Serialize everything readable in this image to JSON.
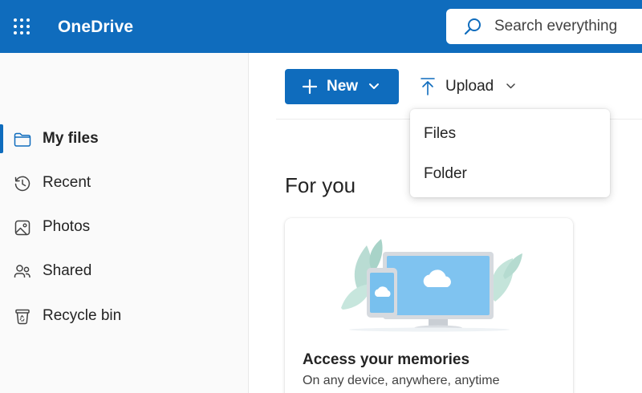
{
  "header": {
    "app_title": "OneDrive",
    "brand_color": "#0f6cbd",
    "search_placeholder": "Search everything"
  },
  "sidebar": {
    "items": [
      {
        "label": "My files",
        "icon": "folder-icon",
        "selected": true
      },
      {
        "label": "Recent",
        "icon": "history-icon",
        "selected": false
      },
      {
        "label": "Photos",
        "icon": "photo-icon",
        "selected": false
      },
      {
        "label": "Shared",
        "icon": "people-icon",
        "selected": false
      },
      {
        "label": "Recycle bin",
        "icon": "recycle-bin-icon",
        "selected": false
      }
    ]
  },
  "toolbar": {
    "new_label": "New",
    "upload_label": "Upload"
  },
  "upload_menu": {
    "items": [
      "Files",
      "Folder"
    ]
  },
  "main": {
    "section_title": "For you",
    "card": {
      "title": "Access your memories",
      "subtitle": "On any device, anywhere, anytime",
      "illustration": "devices-cloud-illustration"
    }
  }
}
